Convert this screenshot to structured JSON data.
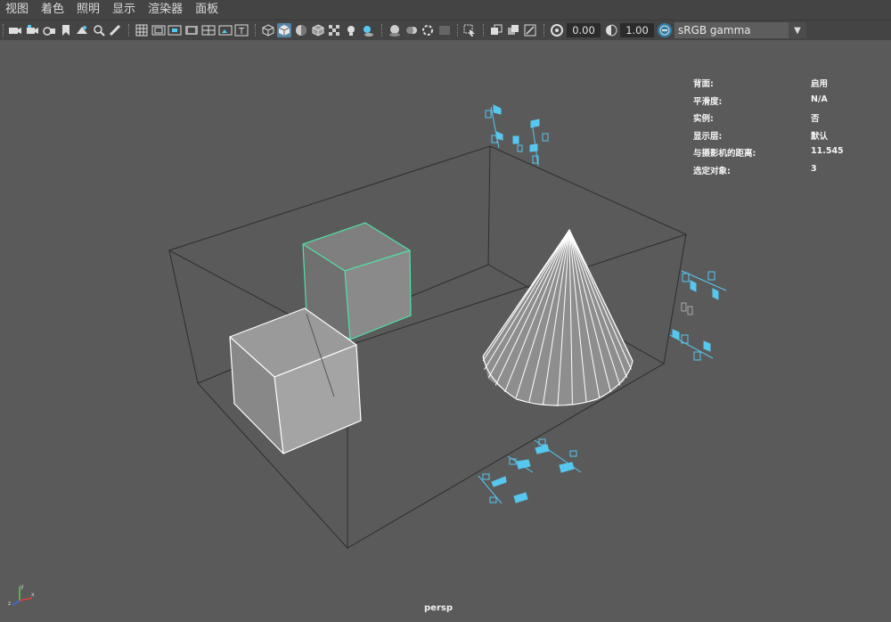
{
  "menu": [
    "视图",
    "着色",
    "照明",
    "显示",
    "渲染器",
    "面板"
  ],
  "toolbar": {
    "gamma_value": "0.00",
    "exposure_value": "1.00",
    "color_space": "sRGB gamma"
  },
  "hud": [
    {
      "label": "背面:",
      "value": "启用"
    },
    {
      "label": "平滑度:",
      "value": "N/A"
    },
    {
      "label": "实例:",
      "value": "否"
    },
    {
      "label": "显示层:",
      "value": "默认"
    },
    {
      "label": "与摄影机的距离:",
      "value": "11.545"
    },
    {
      "label": "选定对象:",
      "value": "3"
    }
  ],
  "camera": "persp",
  "colors": {
    "background": "#5a5a5a",
    "menubar": "#444444",
    "active_icon": "#5285a6",
    "selection_green": "#4fe3a4",
    "manipulator_blue": "#56c8f0"
  }
}
